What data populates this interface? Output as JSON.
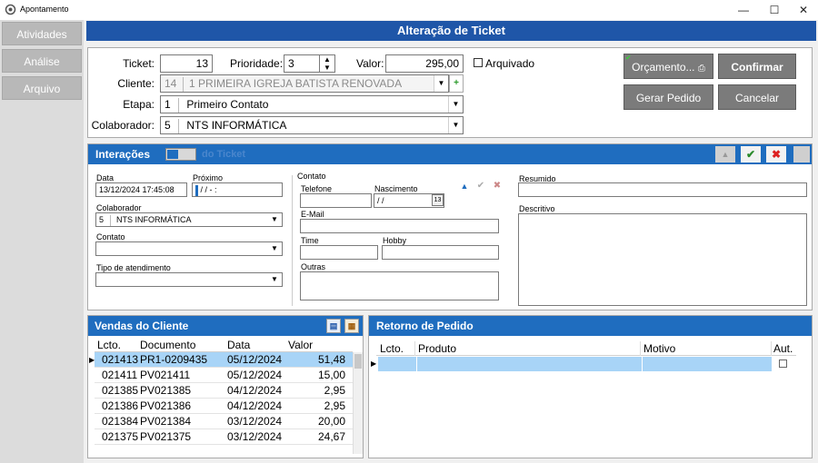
{
  "window": {
    "title": "Apontamento",
    "minimize": "—",
    "maximize": "☐",
    "close": "✕"
  },
  "nav": {
    "items": [
      "Atividades",
      "Análise",
      "Arquivo"
    ]
  },
  "header": {
    "title": "Alteração de Ticket"
  },
  "ticket": {
    "ticket_label": "Ticket:",
    "ticket_value": "13",
    "priority_label": "Prioridade:",
    "priority_value": "3",
    "valor_label": "Valor:",
    "valor_value": "295,00",
    "arquivado_label": "Arquivado",
    "cliente_label": "Cliente:",
    "cliente_code": "14",
    "cliente_name": "1 PRIMEIRA IGREJA BATISTA RENOVADA",
    "etapa_label": "Etapa:",
    "etapa_code": "1",
    "etapa_name": "Primeiro Contato",
    "colab_label": "Colaborador:",
    "colab_code": "5",
    "colab_name": "NTS INFORMÁTICA"
  },
  "actions": {
    "orcamento": "Orçamento...",
    "confirmar": "Confirmar",
    "gerar_pedido": "Gerar Pedido",
    "cancelar": "Cancelar"
  },
  "interacoes": {
    "title": "Interações",
    "toggle_text": "do Ticket",
    "data_label": "Data",
    "data_value": "13/12/2024 17:45:08",
    "proximo_label": "Próximo",
    "proximo_value": "/ /   -  :",
    "colab_label": "Colaborador",
    "colab_code": "5",
    "colab_name": "NTS INFORMÁTICA",
    "contato_label": "Contato",
    "tipo_label": "Tipo de atendimento",
    "contato_group": "Contato",
    "telefone_label": "Telefone",
    "nascimento_label": "Nascimento",
    "nascimento_value": "/ /",
    "email_label": "E-Mail",
    "time_label": "Time",
    "hobby_label": "Hobby",
    "outras_label": "Outras",
    "resumido_label": "Resumido",
    "descritivo_label": "Descritivo"
  },
  "vendas": {
    "title": "Vendas do Cliente",
    "columns": [
      "Lcto.",
      "Documento",
      "Data",
      "Valor"
    ],
    "rows": [
      [
        "021413",
        "PR1-0209435",
        "05/12/2024",
        "51,48"
      ],
      [
        "021411",
        "PV021411",
        "05/12/2024",
        "15,00"
      ],
      [
        "021385",
        "PV021385",
        "04/12/2024",
        "2,95"
      ],
      [
        "021386",
        "PV021386",
        "04/12/2024",
        "2,95"
      ],
      [
        "021384",
        "PV021384",
        "03/12/2024",
        "20,00"
      ],
      [
        "021375",
        "PV021375",
        "03/12/2024",
        "24,67"
      ]
    ]
  },
  "retorno": {
    "title": "Retorno de Pedido",
    "columns": [
      "Lcto.",
      "Produto",
      "Motivo",
      "Aut."
    ]
  },
  "colors": {
    "header_blue": "#1f56a8",
    "section_blue": "#1f6dbf",
    "selected_row": "#a8d4f7",
    "button_gray": "#7b7b7b"
  }
}
